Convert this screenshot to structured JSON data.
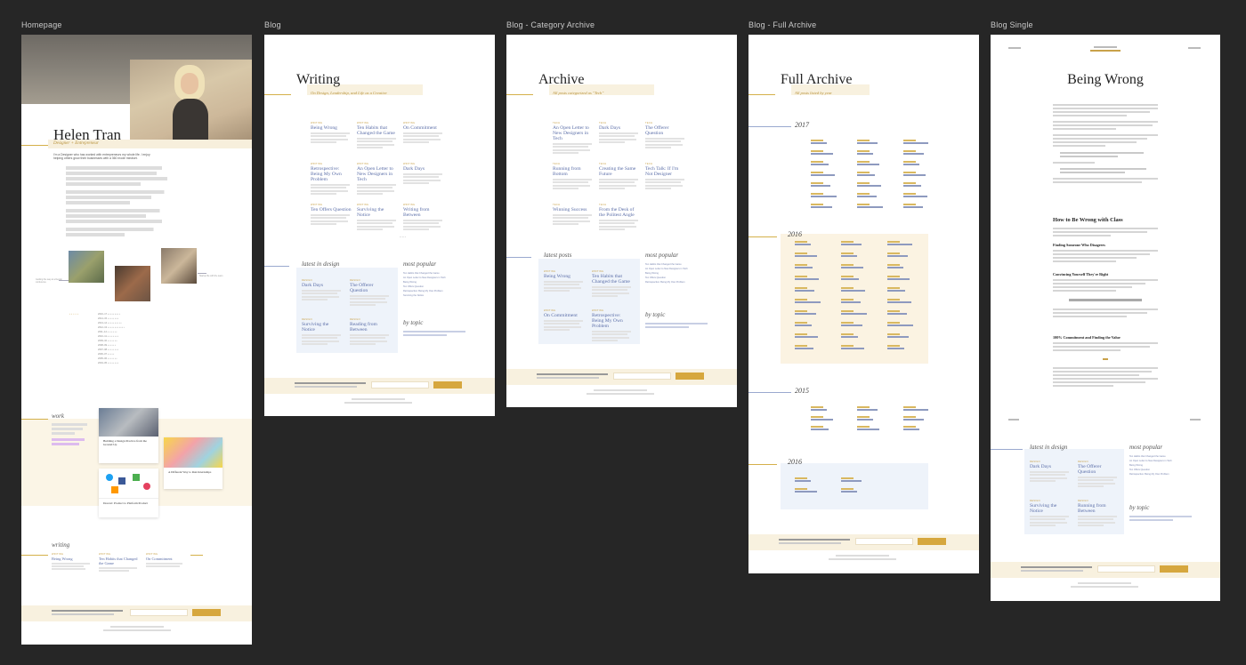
{
  "boards": {
    "homepage": "Homepage",
    "blog": "Blog",
    "category": "Blog - Category Archive",
    "full": "Blog - Full Archive",
    "single": "Blog Single"
  },
  "home": {
    "name": "Helen Tran",
    "role": "Designer + Entrepreneur",
    "intro": "I'm a Designer who has worked with entrepreneurs my whole life. I enjoy helping others grow their businesses with a 360 mode mindset.",
    "work_heading": "work",
    "work_cards": [
      {
        "title": "Building a Design Practice from the Ground Up"
      },
      {
        "title": "A Different Way to Run Internships"
      },
      {
        "title": "Dorewi: Product to Platform Product"
      }
    ],
    "writing_heading": "writing",
    "writing_posts": [
      {
        "meta": "WRITING",
        "title": "Being Wrong"
      },
      {
        "meta": "WRITING",
        "title": "Ten Habits that Changed the Game"
      },
      {
        "meta": "WRITING",
        "title": "On Commitment"
      }
    ],
    "caption_left": "Guiding the way at a Design conference",
    "caption_right": "Startup life with the team"
  },
  "blog": {
    "title": "Writing",
    "subtitle": "On Design, Leadership, and Life as a Creative",
    "posts": [
      {
        "meta": "WRITING",
        "title": "Being Wrong"
      },
      {
        "meta": "WRITING",
        "title": "Ten Habits that Changed the Game"
      },
      {
        "meta": "WRITING",
        "title": "On Commitment"
      },
      {
        "meta": "WRITING",
        "title": "Retrospective: Being My Own Problem"
      },
      {
        "meta": "WRITING",
        "title": "An Open Letter to New Designers in Tech"
      },
      {
        "meta": "WRITING",
        "title": "Dark Days"
      },
      {
        "meta": "WRITING",
        "title": "Ten Offers Question"
      },
      {
        "meta": "WRITING",
        "title": "Surviving the Notice"
      },
      {
        "meta": "WRITING",
        "title": "Writing from Between"
      }
    ],
    "latest_heading": "latest in design",
    "latest_posts": [
      {
        "meta": "DESIGN",
        "title": "Dark Days"
      },
      {
        "meta": "DESIGN",
        "title": "The Offerer Question"
      },
      {
        "meta": "DESIGN",
        "title": "Surviving the Notice"
      },
      {
        "meta": "DESIGN",
        "title": "Reading from Between"
      }
    ],
    "popular_heading": "most popular",
    "popular_items": [
      "Ten Habits that Changed the Game",
      "An Open Letter to New Designers in Tech",
      "Being Wrong",
      "Ten Offers Question",
      "Retrospective: Being My Own Problem",
      "Surviving the Notice"
    ],
    "topic_heading": "by topic"
  },
  "category": {
    "title": "Archive",
    "subtitle": "All posts categorized as \"Tech\"",
    "posts": [
      {
        "meta": "TECH",
        "title": "An Open Letter to New Designers in Tech"
      },
      {
        "meta": "TECH",
        "title": "Dark Days"
      },
      {
        "meta": "TECH",
        "title": "The Offerer Question"
      },
      {
        "meta": "TECH",
        "title": "Running from Bottom"
      },
      {
        "meta": "TECH",
        "title": "Creating the Same Future"
      },
      {
        "meta": "TECH",
        "title": "Tech Talk: If I'm Not Designer"
      },
      {
        "meta": "TECH",
        "title": "Winning Success"
      },
      {
        "meta": "TECH",
        "title": "From the Desk of the Politest Angle"
      }
    ],
    "latest_heading": "latest posts",
    "latest_posts": [
      {
        "meta": "WRITING",
        "title": "Being Wrong"
      },
      {
        "meta": "WRITING",
        "title": "Ten Habits that Changed the Game"
      },
      {
        "meta": "WRITING",
        "title": "On Commitment"
      },
      {
        "meta": "WRITING",
        "title": "Retrospective: Being My Own Problem"
      }
    ],
    "popular_heading": "most popular",
    "topic_heading": "by topic"
  },
  "full": {
    "title": "Full Archive",
    "subtitle": "All posts listed by year",
    "years": [
      "2017",
      "2016",
      "2015",
      "2016"
    ]
  },
  "single": {
    "title": "Being Wrong",
    "h2": "How to Be Wrong with Class",
    "h3a": "Finding Someone Who Disagrees",
    "h3b": "Convincing Yourself They're Right",
    "h3c": "100% Commitment and Finding the Value",
    "latest_heading": "latest in design",
    "latest_posts": [
      {
        "meta": "DESIGN",
        "title": "Dark Days"
      },
      {
        "meta": "DESIGN",
        "title": "The Offerer Question"
      },
      {
        "meta": "DESIGN",
        "title": "Surviving the Notice"
      },
      {
        "meta": "DESIGN",
        "title": "Running from Between"
      }
    ],
    "popular_heading": "most popular",
    "topic_heading": "by topic"
  },
  "newsletter": {
    "button": "SIGN UP"
  },
  "colors": {
    "accent": "#d4b04a",
    "link": "#5b6ea8",
    "cream": "#f8f1df",
    "blue_panel": "#eef3fa",
    "background": "#262626"
  }
}
